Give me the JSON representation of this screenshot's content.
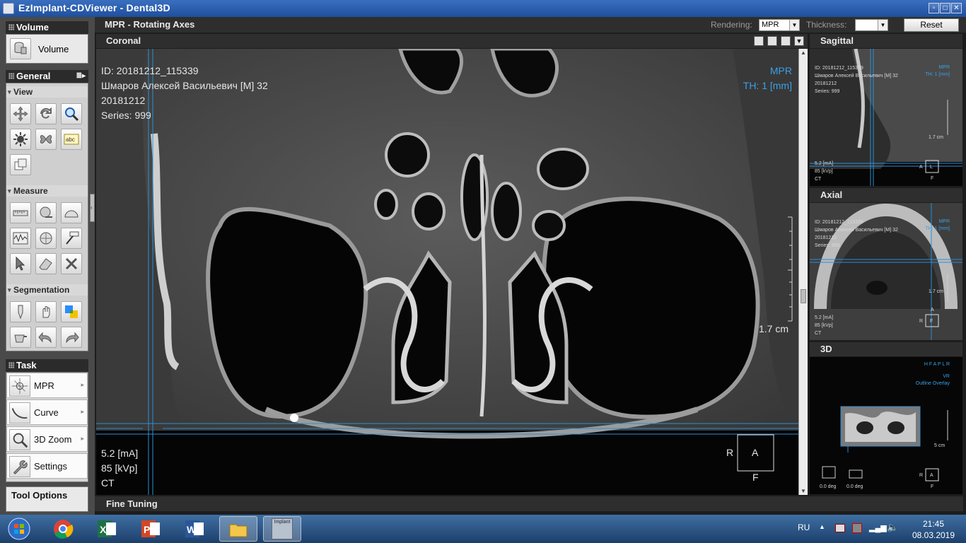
{
  "window": {
    "title": "EzImplant-CDViewer - Dental3D"
  },
  "sections": {
    "volume": {
      "title": "Volume",
      "button": "Volume"
    },
    "general": {
      "title": "General"
    },
    "view": {
      "title": "View"
    },
    "measure": {
      "title": "Measure"
    },
    "segmentation": {
      "title": "Segmentation"
    },
    "task": {
      "title": "Task",
      "items": [
        "MPR",
        "Curve",
        "3D Zoom",
        "Settings"
      ]
    },
    "tool_options": {
      "title": "Tool Options"
    }
  },
  "toolbar": {
    "title": "MPR - Rotating Axes",
    "rendering_label": "Rendering:",
    "rendering_value": "MPR",
    "thickness_label": "Thickness:",
    "thickness_value": "",
    "reset": "Reset"
  },
  "coronal": {
    "title": "Coronal",
    "id": "ID: 20181212_115339",
    "patient": "Шмаров Алексей Васильевич [M] 32",
    "date": "20181212",
    "series": "Series: 999",
    "mode": "MPR",
    "thickness": "TH: 1 [mm]",
    "scale": "1.7 cm",
    "ma": "5.2 [mA]",
    "kvp": "85 [kVp]",
    "modality": "CT",
    "orient_left": "R",
    "orient_box": "A",
    "orient_bottom": "F"
  },
  "sagittal": {
    "title": "Sagittal",
    "id": "ID: 20181212_115339",
    "patient": "Шмаров Алексей Васильевич [M] 32",
    "date": "20181212",
    "series": "Series: 999",
    "mode": "MPR",
    "thickness": "TH: 1 [mm]",
    "scale": "1.7 cm",
    "ma": "5.2 [mA]",
    "kvp": "85 [kVp]",
    "modality": "CT",
    "orient_left": "A",
    "orient_box": "L",
    "orient_bottom": "F"
  },
  "axial": {
    "title": "Axial",
    "id": "ID: 20181212_115339",
    "patient": "Шмаров Алексей Васильевич [M] 32",
    "date": "20181212",
    "series": "Series: 999",
    "mode": "MPR",
    "thickness": "TH: 1 [mm]",
    "scale": "1.7 cm",
    "ma": "5.2 [mA]",
    "kvp": "85 [kVp]",
    "modality": "CT",
    "orient_top": "A",
    "orient_left": "R",
    "orient_box": "F"
  },
  "view3d": {
    "title": "3D",
    "orientation": "H F A P L R",
    "mode": "VR",
    "overlay": "Outline Overlay",
    "scale": "5 cm",
    "deg1": "0.0 deg",
    "deg2": "0.0 deg",
    "orient_left": "R",
    "orient_box": "A",
    "orient_bottom": "F"
  },
  "fine_tuning": {
    "title": "Fine Tuning"
  },
  "taskbar": {
    "lang": "RU",
    "time": "21:45",
    "date": "08.03.2019",
    "implant_label": "Implant"
  },
  "colors": {
    "accent_blue": "#3aa0e6",
    "crosshair": "#2b8fd6"
  }
}
